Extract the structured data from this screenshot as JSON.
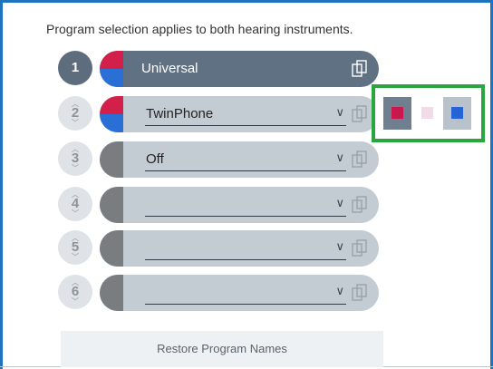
{
  "heading": "Program selection applies to both hearing instruments.",
  "colors": {
    "frame": "#1e73be",
    "active_pill": "#5f7182",
    "inactive_pill": "#c3cbd3",
    "pie_red": "#d2204a",
    "pie_blue": "#2a6fd6",
    "pie_gray": "#7a7d80",
    "highlight": "#2aa640"
  },
  "programs": [
    {
      "number": "1",
      "name": "Universal",
      "active": true,
      "pie": "red-blue"
    },
    {
      "number": "2",
      "name": "TwinPhone",
      "active": false,
      "pie": "red-blue",
      "dropdown_icon": "chevron-down-icon",
      "copy_icon": "copy-icon"
    },
    {
      "number": "3",
      "name": "Off",
      "active": false,
      "pie": "gray"
    },
    {
      "number": "4",
      "name": "",
      "active": false,
      "pie": "gray"
    },
    {
      "number": "5",
      "name": "",
      "active": false,
      "pie": "gray"
    },
    {
      "number": "6",
      "name": "",
      "active": false,
      "pie": "gray"
    }
  ],
  "side_swatches": [
    {
      "name": "red",
      "color": "#c8184e",
      "bg": "#6f7f8f"
    },
    {
      "name": "pink",
      "color": "#f0dbe6",
      "bg": "#ffffff"
    },
    {
      "name": "blue",
      "color": "#2563d6",
      "bg": "#b9c2cb"
    }
  ],
  "restore_label": "Restore Program Names"
}
